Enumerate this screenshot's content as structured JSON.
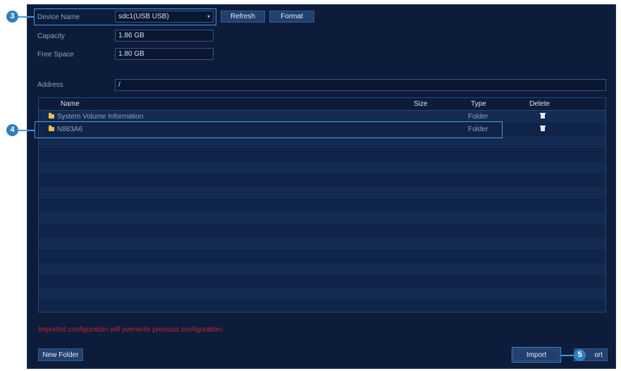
{
  "device": {
    "name_label": "Device Name",
    "name_value": "sdc1(USB USB)",
    "refresh_label": "Refresh",
    "format_label": "Format",
    "capacity_label": "Capacity",
    "capacity_value": "1.86 GB",
    "free_label": "Free Space",
    "free_value": "1.80 GB",
    "address_label": "Address",
    "address_value": "/"
  },
  "table": {
    "headers": {
      "name": "Name",
      "size": "Size",
      "type": "Type",
      "delete": "Delete"
    },
    "rows": [
      {
        "name": "System Volume Information",
        "size": "",
        "type": "Folder"
      },
      {
        "name": "N883A6",
        "size": "",
        "type": "Folder"
      }
    ]
  },
  "warning": "Imported configuration will overwrite previous configuration.",
  "footer": {
    "new_folder_label": "New Folder",
    "import_label": "Import",
    "export_visible_label": "ort"
  },
  "callouts": {
    "c3": "3",
    "c4": "4",
    "c5": "5"
  },
  "colors": {
    "panel_bg": "#0c1c3a",
    "button_bg": "#22406e",
    "callout": "#2f7fbf",
    "highlight": "#3f9be0",
    "warning": "#c4262c",
    "folder": "#e9c24a"
  },
  "icons": {
    "folder": "folder-icon",
    "delete": "trash-icon",
    "dropdown": "caret-down-icon"
  }
}
